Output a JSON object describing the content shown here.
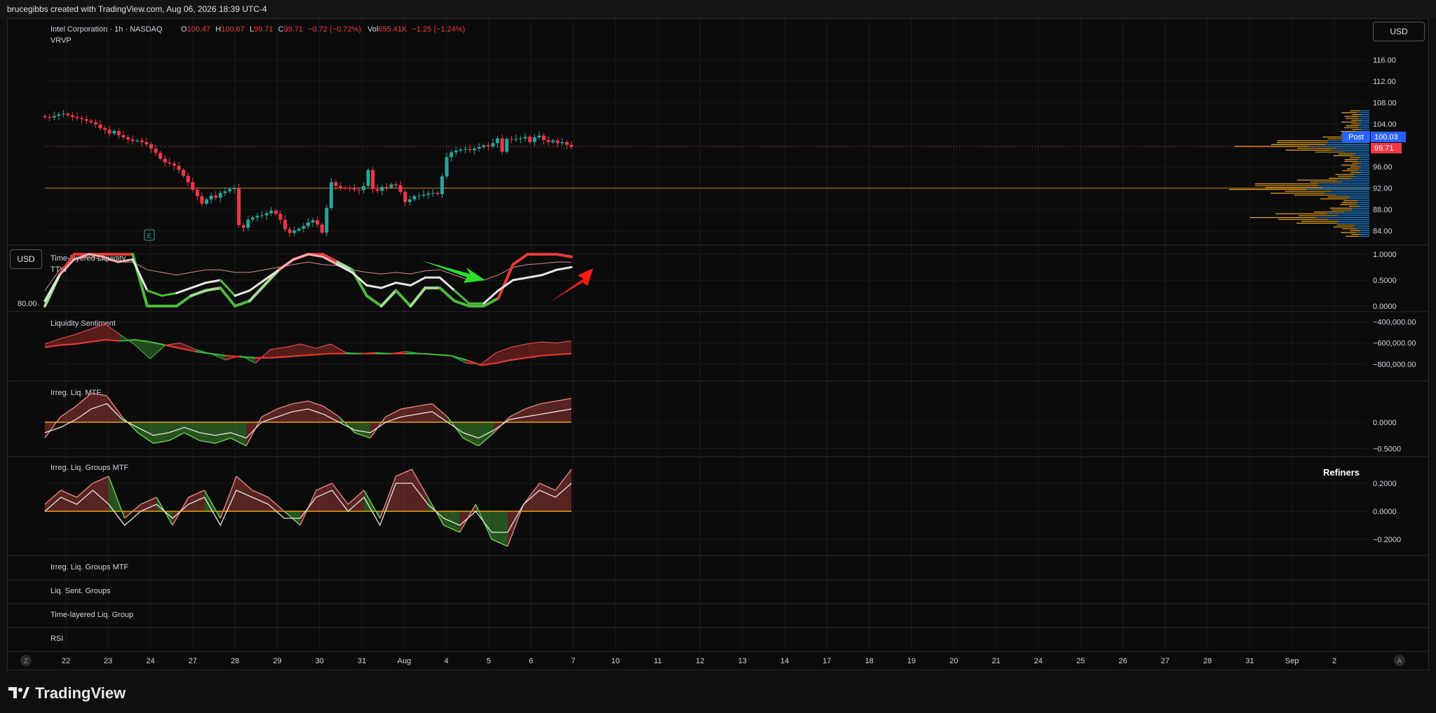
{
  "header": {
    "title": "brucegibbs created with TradingView.com, Aug 06, 2026 18:39 UTC-4"
  },
  "symbol": {
    "name": "Intel Corporation · 1h · NASDAQ",
    "o_label": "O",
    "o": "100.47",
    "h_label": "H",
    "h": "100.67",
    "l_label": "L",
    "l": "99.71",
    "c_label": "C",
    "c": "99.71",
    "change": "−0.72 (−0.72%)",
    "vol_label": "Vol",
    "vol": "655.41K",
    "vol_change": "−1.25 (−1.24%)",
    "vrvp": "VRVP"
  },
  "currency": "USD",
  "price_tags": {
    "post_label": "Post",
    "post": "100.03",
    "last": "99.71"
  },
  "colors": {
    "up": "#26a69a",
    "down": "#f23645",
    "accent_blue": "#2962ff",
    "orange": "#e8a21a",
    "green_line": "#4cbb3a",
    "red_line": "#e53935"
  },
  "panes": {
    "tll": {
      "title": "Time-layered Liquidity",
      "subtitle": "TTW",
      "left_label": "80.00",
      "currency": "USD"
    },
    "ls": {
      "title": "Liquidity Sentiment"
    },
    "irr": {
      "title": "Irreg. Liq. MTF"
    },
    "irrg": {
      "title": "Irreg. Liq. Groups MTF",
      "right_label": "Refiners"
    },
    "collapsed": [
      "Irreg. Liq. Groups MTF",
      "Liq. Sent. Groups",
      "Time-layered Liq. Group",
      "RSI"
    ]
  },
  "axis": {
    "time_labels": [
      "22",
      "23",
      "24",
      "27",
      "28",
      "29",
      "30",
      "31",
      "Aug",
      "4",
      "5",
      "6",
      "7",
      "10",
      "11",
      "12",
      "13",
      "14",
      "17",
      "18",
      "19",
      "20",
      "21",
      "24",
      "25",
      "26",
      "27",
      "28",
      "31",
      "Sep",
      "2"
    ],
    "z_btn": "Z",
    "a_btn": "A"
  },
  "brand": {
    "name": "TradingView"
  },
  "chart_data": [
    {
      "type": "candlestick",
      "title": "Intel Corporation · 1h · NASDAQ",
      "ylim": [
        82,
        118
      ],
      "y_ticks": [
        "116.00",
        "112.00",
        "108.00",
        "104.00",
        "100.00",
        "96.00",
        "92.00",
        "88.00",
        "84.00"
      ],
      "horizontal_line": 92.0,
      "annotation": "E",
      "close": [
        105.3,
        105.2,
        105.5,
        105.8,
        105.9,
        105.6,
        105.3,
        105.1,
        104.9,
        104.6,
        104.3,
        103.9,
        103.2,
        102.9,
        102.2,
        102.7,
        101.9,
        101.5,
        101.1,
        100.8,
        100.9,
        100.6,
        100.2,
        99.4,
        98.6,
        97.5,
        96.8,
        96.6,
        96.2,
        95.4,
        94.3,
        93.1,
        91.7,
        90.5,
        89.1,
        89.9,
        90.6,
        90.2,
        91.1,
        91.4,
        91.8,
        92.0,
        85.1,
        84.6,
        86.1,
        86.5,
        86.8,
        86.9,
        87.3,
        87.8,
        87.2,
        86.1,
        84.3,
        83.6,
        84.1,
        84.4,
        84.9,
        85.6,
        86.0,
        85.2,
        83.7,
        88.3,
        93.1,
        92.4,
        92.1,
        92.0,
        91.9,
        91.7,
        91.6,
        92.4,
        95.4,
        91.8,
        91.5,
        92.2,
        92.1,
        92.7,
        92.5,
        91.3,
        89.4,
        89.9,
        90.5,
        90.6,
        90.8,
        91.0,
        91.1,
        90.9,
        94.2,
        97.8,
        98.7,
        99.0,
        99.2,
        99.3,
        99.1,
        99.4,
        99.7,
        100.0,
        99.8,
        100.4,
        101.3,
        98.8,
        101.2,
        101.1,
        101.2,
        101.3,
        101.6,
        100.6,
        101.5,
        101.8,
        101.0,
        100.6,
        100.9,
        100.4,
        100.6,
        100.1,
        99.71
      ],
      "post": 100.03,
      "last": 99.71
    },
    {
      "type": "line",
      "title": "Time-layered Liquidity",
      "ylim": [
        0,
        1
      ],
      "y_ticks": [
        "1.0000",
        "0.5000",
        "0.0000"
      ],
      "series": [
        {
          "values": [
            0.0,
            0.6,
            1.0,
            1.0,
            1.0,
            1.0,
            1.0,
            0.0,
            0.0,
            0.0,
            0.2,
            0.3,
            0.35,
            0.0,
            0.1,
            0.4,
            0.7,
            0.9,
            1.0,
            1.0,
            0.85,
            0.7,
            0.2,
            0.0,
            0.3,
            0.0,
            0.35,
            0.35,
            0.1,
            0.0,
            0.0,
            0.15,
            0.8,
            1.0,
            1.0,
            1.0,
            0.95
          ]
        },
        {
          "values": [
            0.1,
            0.6,
            0.9,
            1.0,
            0.95,
            0.85,
            0.9,
            0.3,
            0.2,
            0.25,
            0.35,
            0.45,
            0.5,
            0.2,
            0.3,
            0.5,
            0.7,
            0.9,
            1.0,
            0.95,
            0.8,
            0.65,
            0.4,
            0.35,
            0.45,
            0.4,
            0.55,
            0.55,
            0.3,
            0.05,
            0.05,
            0.3,
            0.5,
            0.55,
            0.6,
            0.7,
            0.75
          ]
        },
        {
          "values": [
            0.3,
            0.7,
            0.9,
            0.95,
            0.9,
            0.85,
            0.85,
            0.7,
            0.65,
            0.6,
            0.65,
            0.7,
            0.7,
            0.65,
            0.65,
            0.7,
            0.75,
            0.8,
            0.85,
            0.8,
            0.78,
            0.7,
            0.65,
            0.62,
            0.65,
            0.62,
            0.68,
            0.7,
            0.6,
            0.5,
            0.5,
            0.6,
            0.75,
            0.8,
            0.82,
            0.85,
            0.85
          ]
        }
      ]
    },
    {
      "type": "area",
      "title": "Liquidity Sentiment",
      "ylim": [
        -900000,
        -350000
      ],
      "y_ticks": [
        "−400,000.00",
        "−600,000.00",
        "−800,000.00"
      ],
      "series": [
        {
          "values": [
            -610000,
            -560000,
            -520000,
            -470000,
            -420000,
            -520000,
            -620000,
            -750000,
            -620000,
            -600000,
            -660000,
            -700000,
            -760000,
            -720000,
            -790000,
            -660000,
            -640000,
            -610000,
            -650000,
            -610000,
            -690000,
            -700000,
            -690000,
            -700000,
            -680000,
            -700000,
            -710000,
            -720000,
            -790000,
            -800000,
            -690000,
            -640000,
            -610000,
            -590000,
            -600000,
            -580000
          ]
        },
        {
          "values": [
            -640000,
            -620000,
            -610000,
            -590000,
            -570000,
            -580000,
            -570000,
            -590000,
            -620000,
            -650000,
            -680000,
            -700000,
            -720000,
            -730000,
            -740000,
            -740000,
            -730000,
            -720000,
            -710000,
            -700000,
            -700000,
            -700000,
            -700000,
            -700000,
            -700000,
            -700000,
            -710000,
            -720000,
            -760000,
            -810000,
            -790000,
            -760000,
            -740000,
            -720000,
            -710000,
            -700000
          ]
        }
      ]
    },
    {
      "type": "area",
      "title": "Irreg. Liq. MTF",
      "ylim": [
        -0.6,
        0.7
      ],
      "y_ticks": [
        "0.0000",
        "−0.5000"
      ],
      "series": [
        {
          "values": [
            -0.3,
            0.1,
            0.3,
            0.55,
            0.5,
            0.1,
            -0.2,
            -0.4,
            -0.35,
            -0.2,
            -0.35,
            -0.4,
            -0.3,
            -0.45,
            0.1,
            0.25,
            0.35,
            0.4,
            0.3,
            0.1,
            -0.2,
            -0.3,
            0.1,
            0.25,
            0.3,
            0.35,
            0.1,
            -0.3,
            -0.45,
            -0.2,
            0.1,
            0.25,
            0.35,
            0.4,
            0.45
          ]
        },
        {
          "values": [
            -0.2,
            -0.1,
            0.05,
            0.25,
            0.35,
            0.05,
            -0.1,
            -0.25,
            -0.2,
            -0.1,
            -0.2,
            -0.25,
            -0.2,
            -0.3,
            0.0,
            0.1,
            0.2,
            0.25,
            0.15,
            0.0,
            -0.15,
            -0.2,
            0.0,
            0.1,
            0.15,
            0.2,
            0.0,
            -0.2,
            -0.3,
            -0.15,
            0.05,
            0.1,
            0.15,
            0.2,
            0.25
          ]
        }
      ]
    },
    {
      "type": "area",
      "title": "Irreg. Liq. Groups MTF",
      "ylim": [
        -0.3,
        0.35
      ],
      "y_ticks": [
        "0.2000",
        "0.0000",
        "−0.2000"
      ],
      "series": [
        {
          "values": [
            0.05,
            0.15,
            0.1,
            0.2,
            0.25,
            -0.05,
            0.05,
            0.1,
            -0.1,
            0.1,
            0.15,
            -0.05,
            0.25,
            0.15,
            0.1,
            0.0,
            -0.1,
            0.15,
            0.2,
            0.05,
            0.15,
            -0.05,
            0.25,
            0.3,
            0.1,
            -0.1,
            -0.15,
            0.05,
            -0.2,
            -0.25,
            0.05,
            0.2,
            0.15,
            0.3
          ]
        },
        {
          "values": [
            0.0,
            0.1,
            0.05,
            0.15,
            0.05,
            -0.1,
            0.0,
            0.05,
            -0.05,
            0.05,
            0.1,
            -0.1,
            0.15,
            0.1,
            0.05,
            -0.05,
            -0.05,
            0.1,
            0.15,
            0.0,
            0.1,
            -0.1,
            0.2,
            0.2,
            0.05,
            -0.05,
            -0.1,
            0.0,
            -0.15,
            -0.15,
            0.05,
            0.15,
            0.1,
            0.2
          ]
        }
      ]
    }
  ]
}
